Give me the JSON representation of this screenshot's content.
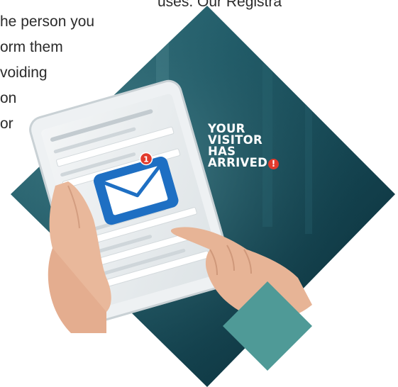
{
  "background_text": {
    "lines": [
      "uses. Our Registra",
      "he person you",
      "orm them",
      "voiding",
      "on",
      "or"
    ]
  },
  "notification": {
    "badge_count": "1",
    "headline": [
      "YOUR",
      "VISITOR",
      "HAS",
      "ARRIVED"
    ],
    "exclamation": "!"
  },
  "colors": {
    "hero_dark": "#0f3a45",
    "hero_mid": "#1f5b68",
    "accent_teal": "#4f9a97",
    "envelope_blue": "#1e6fc3",
    "badge_red": "#e23a2c"
  },
  "icons": [
    "envelope-icon",
    "notification-badge",
    "exclamation-icon"
  ]
}
